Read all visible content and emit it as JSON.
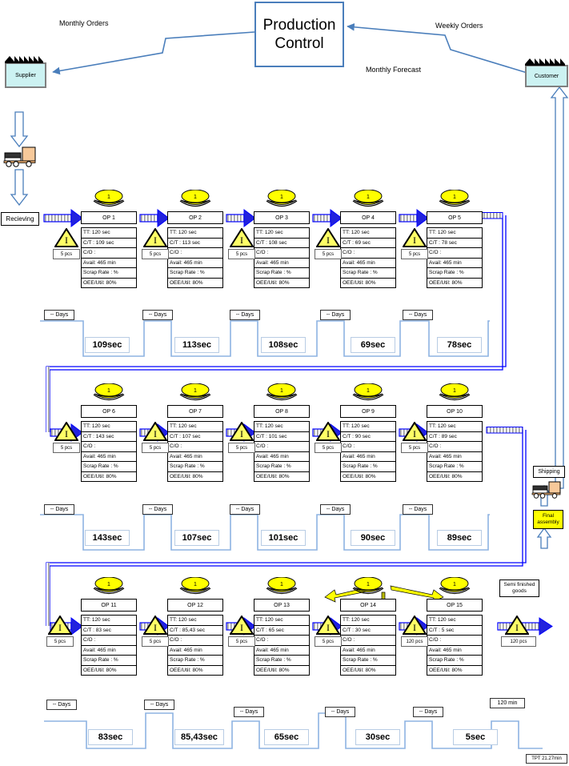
{
  "title_box": {
    "line1": "Production",
    "line2": "Control"
  },
  "flow_labels": {
    "monthly_orders": "Monthly Orders",
    "weekly_orders": "Weekly Orders",
    "monthly_forecast": "Monthly Forecast"
  },
  "external": {
    "supplier": "Supplier",
    "customer": "Customer",
    "receiving": "Recieving",
    "shipping": "Shipping",
    "final_assembly_l1": "Final",
    "final_assembly_l2": "assembly",
    "semi_finished_l1": "Semi finished",
    "semi_finished_l2": "goods"
  },
  "data_box_labels": {
    "tt": "TT: 120 sec",
    "co": "C/O :",
    "avail": "Avail: 465 min",
    "scrap": "Scrap Rate : %",
    "oee": "OEE/Util: 80%"
  },
  "operations": [
    {
      "name": "OP 1",
      "ct": "C/T : 109 sec",
      "inv": "5 pcs"
    },
    {
      "name": "OP 2",
      "ct": "C/T : 113 sec",
      "inv": "5 pcs"
    },
    {
      "name": "OP 3",
      "ct": "C/T : 108 sec",
      "inv": "5 pcs"
    },
    {
      "name": "OP 4",
      "ct": "C/T : 69 sec",
      "inv": "5 pcs"
    },
    {
      "name": "OP 5",
      "ct": "C/T : 78 sec",
      "inv": "5 pcs"
    },
    {
      "name": "OP 6",
      "ct": "C/T : 143 sec",
      "inv": "5 pcs"
    },
    {
      "name": "OP 7",
      "ct": "C/T : 107 sec",
      "inv": "5 pcs"
    },
    {
      "name": "OP 8",
      "ct": "C/T : 101 sec",
      "inv": "5 pcs"
    },
    {
      "name": "OP 9",
      "ct": "C/T : 90 sec",
      "inv": "5 pcs"
    },
    {
      "name": "OP 10",
      "ct": "C/T : 89 sec",
      "inv": "5 pcs"
    },
    {
      "name": "OP 11",
      "ct": "C/T : 83 sec",
      "inv": "5 pcs"
    },
    {
      "name": "OP 12",
      "ct": "C/T : 85,43 sec",
      "inv": "5 pcs"
    },
    {
      "name": "OP 13",
      "ct": "C/T : 65 sec",
      "inv": "5 pcs"
    },
    {
      "name": "OP 14",
      "ct": "C/T : 30 sec",
      "inv": "5 pcs"
    },
    {
      "name": "OP 15",
      "ct": "C/T : 5 sec",
      "inv": "120 pcs"
    }
  ],
  "operator_badge": "1",
  "final_inventory": "120 pcs",
  "timeline": {
    "day_label": "-- Days",
    "row1": [
      {
        "delay": "-- Days",
        "value": "109sec"
      },
      {
        "delay": "-- Days",
        "value": "113sec"
      },
      {
        "delay": "-- Days",
        "value": "108sec"
      },
      {
        "delay": "-- Days",
        "value": "69sec"
      },
      {
        "delay": "-- Days",
        "value": "78sec"
      }
    ],
    "row2": [
      {
        "delay": "-- Days",
        "value": "143sec"
      },
      {
        "delay": "-- Days",
        "value": "107sec"
      },
      {
        "delay": "-- Days",
        "value": "101sec"
      },
      {
        "delay": "-- Days",
        "value": "90sec"
      },
      {
        "delay": "-- Days",
        "value": "89sec"
      }
    ],
    "row3": [
      {
        "delay": "-- Days",
        "value": "83sec"
      },
      {
        "delay": "-- Days",
        "value": "85,43sec"
      },
      {
        "delay": "-- Days",
        "value": "65sec"
      },
      {
        "delay": "-- Days",
        "value": "30sec"
      },
      {
        "delay": "-- Days",
        "value": "5sec"
      },
      {
        "delay": "120 min",
        "value": ""
      }
    ],
    "tpt": "TPT 21.27min"
  },
  "colors": {
    "accent_blue": "#4a7ebb",
    "material_blue": "#0000ff",
    "kaizen_yellow": "#ffff00",
    "external_fill": "#ccf2f2"
  }
}
